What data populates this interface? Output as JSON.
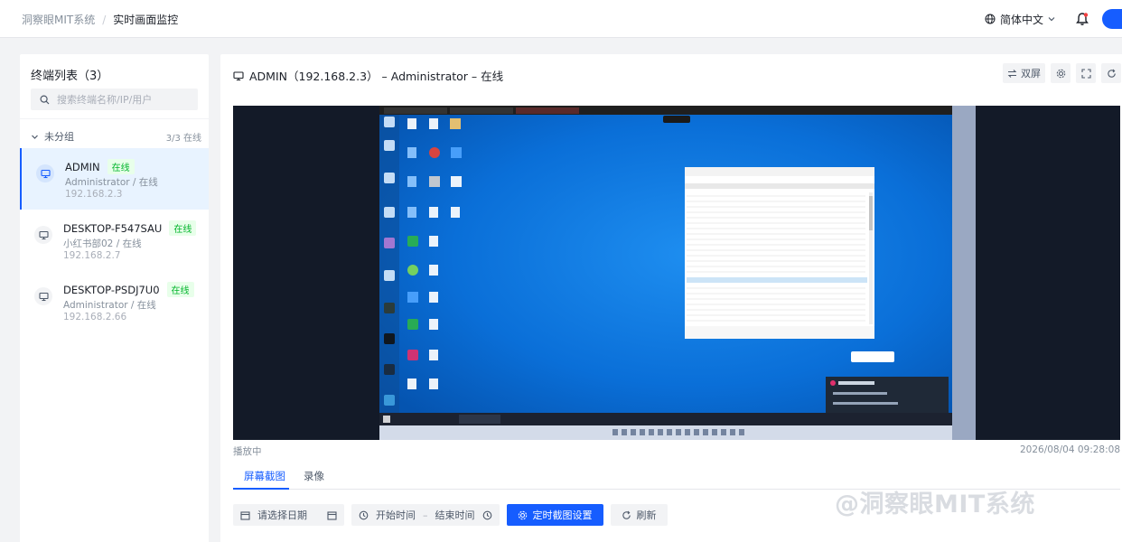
{
  "header": {
    "breadcrumb_parent": "洞察眼MIT系统",
    "breadcrumb_sep": "/",
    "breadcrumb_current": "实时画面监控",
    "language": "简体中文"
  },
  "sidebar": {
    "title": "终端列表（3）",
    "search_placeholder": "搜索终端名称/IP/用户",
    "group": {
      "name": "未分组",
      "count": "3/3 在线"
    },
    "terminals": [
      {
        "name": "ADMIN",
        "status": "在线",
        "user": "Administrator / 在线",
        "ip": "192.168.2.3"
      },
      {
        "name": "DESKTOP-F547SAU",
        "status": "在线",
        "user": "小红书部02 / 在线",
        "ip": "192.168.2.7"
      },
      {
        "name": "DESKTOP-PSDJ7U0",
        "status": "在线",
        "user": "Administrator / 在线",
        "ip": "192.168.2.66"
      }
    ]
  },
  "viewer": {
    "title": "ADMIN（192.168.2.3） – Administrator – 在线",
    "dual_screen_label": "双屏",
    "playback_status": "播放中",
    "timestamp": "2026/08/04 09:28:08"
  },
  "tabs": [
    "屏幕截图",
    "录像"
  ],
  "filters": {
    "date_placeholder": "请选择日期",
    "start_time": "开始时间",
    "range_sep": "–",
    "end_time": "结束时间",
    "schedule_button": "定时截图设置",
    "refresh_button": "刷新"
  },
  "watermark": "@洞察眼MIT系统",
  "colors": {
    "accent": "#165dff",
    "online": "#00b42a",
    "desktop": "#0a6fd8"
  }
}
